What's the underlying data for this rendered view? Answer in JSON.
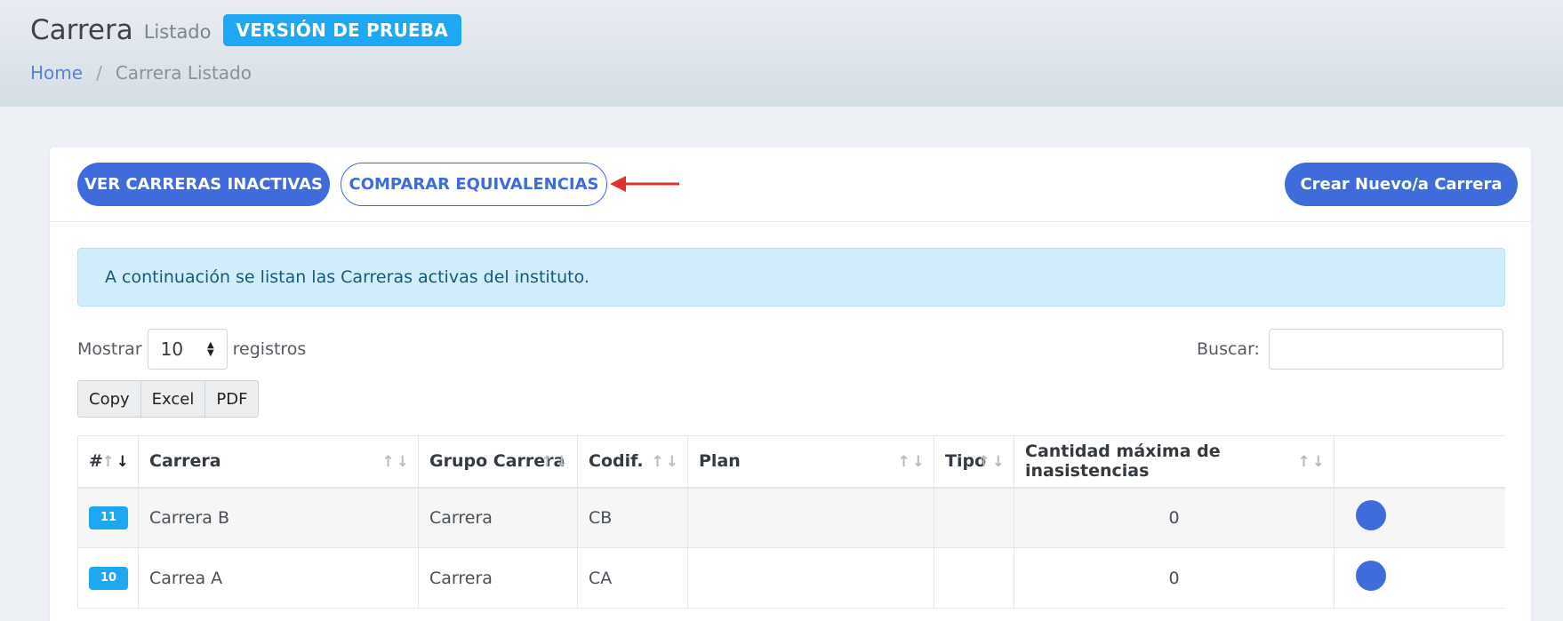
{
  "header": {
    "title": "Carrera",
    "subtitle": "Listado",
    "badge": "VERSIÓN DE PRUEBA",
    "breadcrumb": {
      "home": "Home",
      "separator": "/",
      "current": "Carrera Listado"
    }
  },
  "toolbar": {
    "inactive_label": "VER CARRERAS INACTIVAS",
    "compare_label": "COMPARAR EQUIVALENCIAS",
    "create_label": "Crear Nuevo/a Carrera"
  },
  "alert": {
    "text": "A continuación se listan las Carreras activas del instituto."
  },
  "table_controls": {
    "show_label": "Mostrar",
    "page_length": "10",
    "records_label": "registros",
    "search_label": "Buscar:",
    "search_value": "",
    "export_buttons": [
      "Copy",
      "Excel",
      "PDF"
    ]
  },
  "table": {
    "columns": [
      "#",
      "Carrera",
      "Grupo Carrera",
      "Codif.",
      "Plan",
      "Tipo",
      "Cantidad máxima de inasistencias",
      ""
    ],
    "rows": [
      {
        "id": "11",
        "carrera": "Carrera B",
        "grupo": "Carrera",
        "codif": "CB",
        "plan": "",
        "tipo": "",
        "inasistencias": "0"
      },
      {
        "id": "10",
        "carrera": "Carrea A",
        "grupo": "Carrera",
        "codif": "CA",
        "plan": "",
        "tipo": "",
        "inasistencias": "0"
      }
    ]
  },
  "colors": {
    "primary": "#3f6bdb",
    "badge": "#1ea7f2",
    "alert_bg": "#d1edfc",
    "annotation_arrow": "#e03030"
  },
  "icons": {
    "sort": "sort-arrows-icon",
    "select_caret": "up-down-caret-icon",
    "annotation": "red-arrow-icon",
    "row_action": "row-action-icon"
  }
}
